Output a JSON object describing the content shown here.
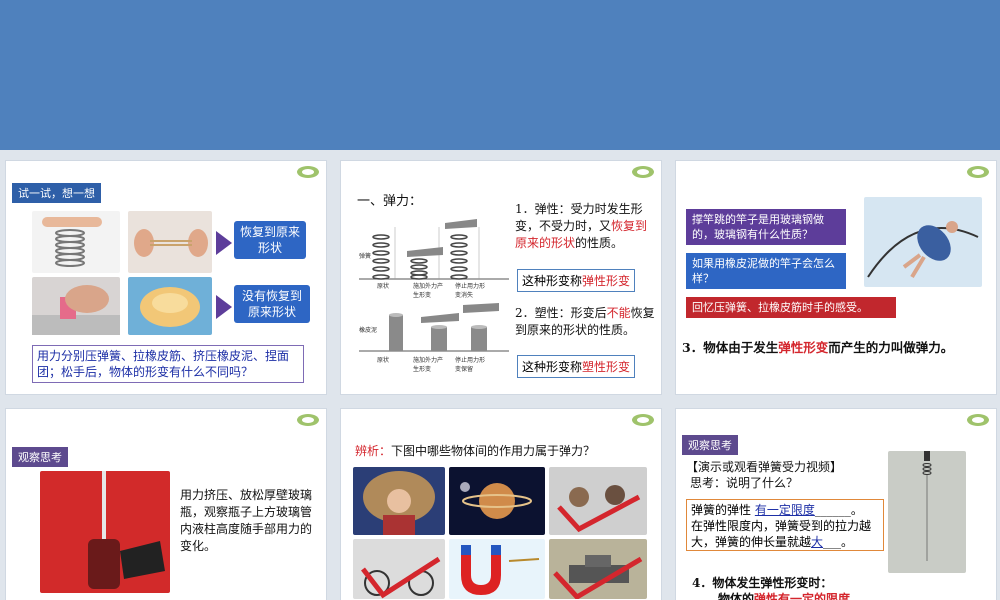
{
  "slide1": {
    "tag": "试一试，想一想",
    "box_top": "恢复到原来形状",
    "box_bottom": "没有恢复到原来形状",
    "question": "用力分别压弹簧、拉橡皮筋、挤压橡皮泥、捏面团；松手后，物体的形变有什么不同吗？"
  },
  "slide2": {
    "heading": "一、弹力：",
    "p1_prefix": "1．弹性：受力时发生形变，不受力时，又",
    "p1_red": "恢复到原来的形状",
    "p1_suffix": "的性质。",
    "box1_prefix": "这种形变称",
    "box1_red": "弹性形变",
    "p2_prefix": "2．塑性：形变后",
    "p2_red": "不能",
    "p2_suffix": "恢复到原来的形状的性质。",
    "box2_prefix": "这种形变称",
    "box2_red": "塑性形变",
    "spring_label": "弹簧",
    "spring_captions": [
      "原状",
      "施加外力产生形变",
      "停止用力形变消失"
    ],
    "clay_label": "橡皮泥",
    "clay_captions": [
      "原状",
      "施加外力产生形变",
      "停止用力形变保留"
    ]
  },
  "slide3": {
    "q1": "撑竿跳的竿子是用玻璃钢做的，玻璃钢有什么性质？",
    "q2": "如果用橡皮泥做的竿子会怎么样？",
    "q3": "回忆压弹簧、拉橡皮筋时手的感受。",
    "def_prefix": "3．物体由于发生",
    "def_red": "弹性形变",
    "def_suffix": "而产生的力叫做弹力。"
  },
  "slide4": {
    "tag": "观察思考",
    "text": "用力挤压、放松厚壁玻璃瓶，观察瓶子上方玻璃管内液柱高度随手部用力的变化。"
  },
  "slide5": {
    "label": "辨析：",
    "question": "下图中哪些物体间的作用力属于弹力？"
  },
  "slide6": {
    "tag": "观察思考",
    "line1": "【演示或观看弹簧受力视频】",
    "line2": "思考：说明了什么？",
    "fill1_prefix": "弹簧的弹性",
    "fill1_answer": "有一定限度",
    "fill1_suffix": "。",
    "fill2": "在弹性限度内，弹簧受到的拉力越大，弹簧的伸长量就越",
    "fill2_answer": "大",
    "fill2_suffix": "。",
    "p4": "4．物体发生弹性形变时：",
    "p4b_prefix": "物体的",
    "p4b_red": "弹性有一定的限度"
  },
  "colors": {
    "banner": "#4f81bd",
    "accent_blue": "#2e66c4",
    "accent_purple": "#5d4a8e",
    "red": "#d4262d"
  }
}
